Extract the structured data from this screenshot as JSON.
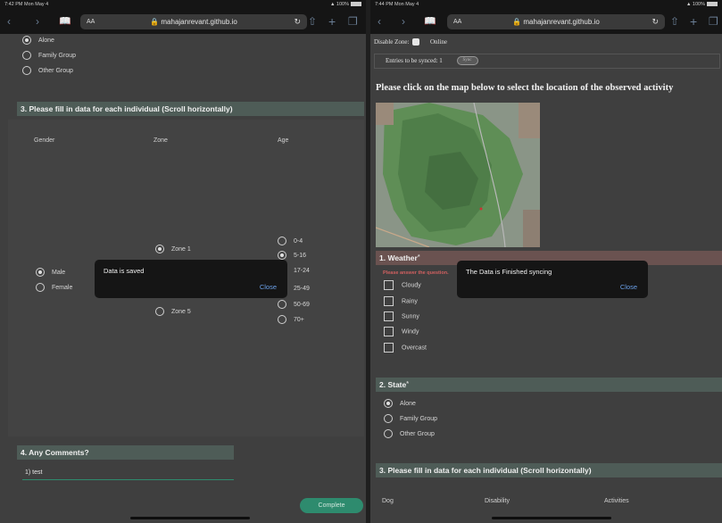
{
  "left": {
    "status_time": "7:42 PM  Mon May 4",
    "status_right": "▲ 100%",
    "aa": "ᴀA",
    "url": "🔒 mahajanrevant.github.io",
    "state_options": [
      {
        "label": "Alone",
        "checked": true
      },
      {
        "label": "Family Group",
        "checked": false
      },
      {
        "label": "Other Group",
        "checked": false
      }
    ],
    "section3_title": "3. Please fill in data for each individual (Scroll horizontally)",
    "columns": [
      "Gender",
      "Zone",
      "Age"
    ],
    "gender_options": [
      {
        "label": "Male",
        "checked": true
      },
      {
        "label": "Female",
        "checked": false
      }
    ],
    "zone_options": [
      {
        "label": "Zone 1",
        "checked": true
      },
      {
        "label": "Zone 5",
        "checked": false
      }
    ],
    "age_options": [
      {
        "label": "0-4",
        "checked": false
      },
      {
        "label": "5-16",
        "checked": true
      },
      {
        "label": "17-24",
        "checked": false
      },
      {
        "label": "25-49",
        "checked": false
      },
      {
        "label": "50-69",
        "checked": false
      },
      {
        "label": "70+",
        "checked": false
      }
    ],
    "toast_message": "Data is saved",
    "toast_close": "Close",
    "section4_title": "4. Any Comments?",
    "comment_value": "1) test",
    "complete_label": "Complete"
  },
  "right": {
    "status_time": "7:44 PM  Mon May 4",
    "status_right": "▲ 100%",
    "aa": "ᴀA",
    "url": "🔒 mahajanrevant.github.io",
    "disable_zone_label": "Disable Zone:",
    "online_label": "Online",
    "entries_label": "Entries to be synced: 1",
    "sync_label": "Sync",
    "map_instruction": "Please click on the map below to select the location of the observed activity",
    "weather_title": "1. Weather",
    "required_mark": "*",
    "answer_warning": "Please answer the question.",
    "weather_options": [
      "Cloudy",
      "Rainy",
      "Sunny",
      "Windy",
      "Overcast"
    ],
    "toast_message": "The Data is Finished syncing",
    "toast_close": "Close",
    "state_title": "2. State",
    "state_options": [
      {
        "label": "Alone",
        "checked": true
      },
      {
        "label": "Family Group",
        "checked": false
      },
      {
        "label": "Other Group",
        "checked": false
      }
    ],
    "section3_title": "3. Please fill in data for each individual (Scroll horizontally)",
    "columns": [
      "Dog",
      "Disability",
      "Activities"
    ]
  },
  "colors": {
    "accent_teal": "#2e8b6e",
    "section_bg": "#4e5c57",
    "weather_bg": "#6a5250",
    "link_blue": "#6a9fe6"
  }
}
